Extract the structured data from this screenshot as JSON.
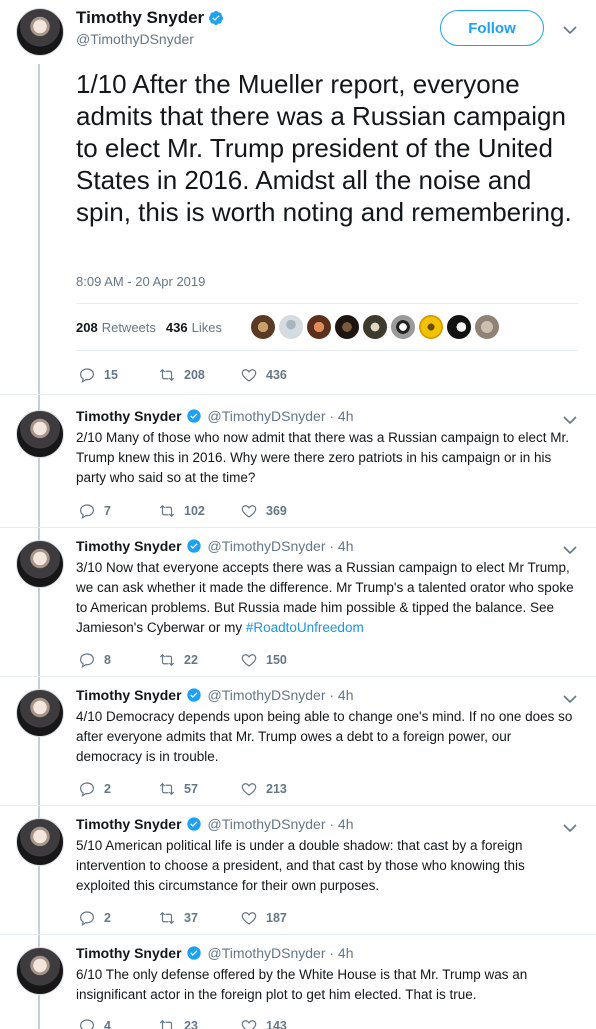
{
  "main_tweet": {
    "name": "Timothy Snyder",
    "handle": "@TimothyDSnyder",
    "follow_label": "Follow",
    "text": "1/10  After the Mueller report, everyone admits that there was a Russian campaign to elect Mr. Trump president of the United States in 2016. Amidst all the noise and spin, this is worth noting and remembering.",
    "timestamp": "8:09 AM - 20 Apr 2019",
    "retweets_count": "208",
    "retweets_label": "Retweets",
    "likes_count": "436",
    "likes_label": "Likes",
    "reply_count": "15",
    "retweet_count": "208",
    "like_count": "436"
  },
  "replies": [
    {
      "name": "Timothy Snyder",
      "handle": "@TimothyDSnyder · 4h",
      "text": "2/10  Many of those who now admit that there was a Russian campaign to elect Mr. Trump knew this in 2016. Why were there zero patriots in his campaign or in his party who said so at the time?",
      "reply_count": "7",
      "retweet_count": "102",
      "like_count": "369"
    },
    {
      "name": "Timothy Snyder",
      "handle": "@TimothyDSnyder · 4h",
      "text": "3/10 Now that everyone accepts there was a Russian campaign to elect Mr Trump, we can ask whether it made the difference. Mr Trump's a talented orator who spoke to American problems. But Russia made him possible & tipped the balance. See Jamieson's Cyberwar or my ",
      "hashtag": "#RoadtoUnfreedom",
      "reply_count": "8",
      "retweet_count": "22",
      "like_count": "150"
    },
    {
      "name": "Timothy Snyder",
      "handle": "@TimothyDSnyder · 4h",
      "text": "4/10  Democracy depends upon being able to change one's mind. If no one does so after everyone admits that Mr. Trump owes a debt to a foreign power, our democracy is in trouble.",
      "reply_count": "2",
      "retweet_count": "57",
      "like_count": "213"
    },
    {
      "name": "Timothy Snyder",
      "handle": "@TimothyDSnyder · 4h",
      "text": "5/10  American political life is under a double shadow: that cast by a foreign intervention to choose a president, and that cast by those who knowing this exploited this circumstance for their own purposes.",
      "reply_count": "2",
      "retweet_count": "37",
      "like_count": "187"
    },
    {
      "name": "Timothy Snyder",
      "handle": "@TimothyDSnyder · 4h",
      "text": "6/10  The only defense offered by the White House is that Mr. Trump was an insignificant actor in the foreign plot to get him elected. That is true.",
      "reply_count": "4",
      "retweet_count": "23",
      "like_count": "143"
    }
  ],
  "colors": {
    "accent": "#1da1f2",
    "secondary_text": "#657786",
    "hashtag": "#1b95e0"
  }
}
